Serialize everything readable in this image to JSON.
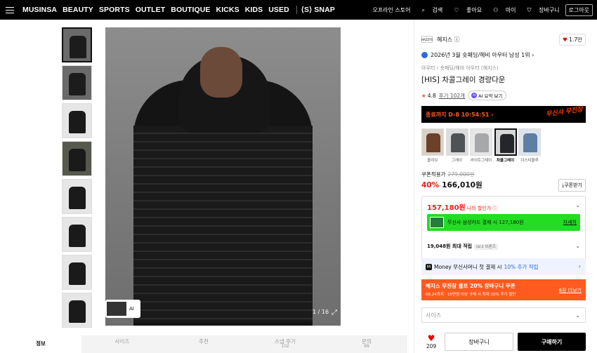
{
  "topbar": {
    "nav": [
      "MUSINSA",
      "BEAUTY",
      "SPORTS",
      "OUTLET",
      "BOUTIQUE",
      "KICKS",
      "KIDS",
      "USED"
    ],
    "snap": "⟨S⟩ SNAP",
    "util": {
      "offline": "오프라인 스토어",
      "search": "검색",
      "likes": "좋아요",
      "my": "마이",
      "cart": "장바구니",
      "logout": "로그아웃"
    }
  },
  "image": {
    "counter": "1 / 16",
    "ai_label": "AI"
  },
  "tabs": [
    {
      "label": "정보",
      "sub": ""
    },
    {
      "label": "사이즈",
      "sub": ""
    },
    {
      "label": "추천",
      "sub": ""
    },
    {
      "label": "스냅·후기",
      "sub": "102"
    },
    {
      "label": "문의",
      "sub": "98"
    }
  ],
  "product": {
    "brand_logo": "HAZZYS",
    "brand": "헤지스 ⓘ",
    "likes": "1.7만",
    "ranking": "2026년 3월 숏패딩/헤비 아우터 남성 1위 ›",
    "breadcrumb": "아우터 › 숏패딩/헤비 아우터 (헤지스)",
    "title": "[HIS] 차콜그레이 경량다운",
    "rating": "4.8",
    "reviews": "후기 102개",
    "ai_summary": "AI 요약 보기",
    "ai_dot": "AI"
  },
  "promo": {
    "timer": "종료까지 D-8 10:54:51 ›",
    "graffiti": "무신사 무진장"
  },
  "colors": [
    {
      "label": "올리브",
      "color": "#6b3f28",
      "bg": "#d9d0c8"
    },
    {
      "label": "그레이",
      "color": "#505356",
      "bg": "#dcdcdc"
    },
    {
      "label": "라이트그레이",
      "color": "#a6a8aa",
      "bg": "#e7e7e7"
    },
    {
      "label": "차콜그레이",
      "color": "#24262a",
      "bg": "#d6d6d6"
    },
    {
      "label": "더스티블루",
      "color": "#5e7ea3",
      "bg": "#dde3ea"
    }
  ],
  "pricing": {
    "coupon_label": "쿠폰적용가",
    "original": "279,000원",
    "discount": "40%",
    "price": "166,010원",
    "coupon_btn": "⤓쿠폰받기",
    "my_price": "157,180원",
    "my_price_label": "나의 할인가 ⓘ",
    "card_text": "무신사 삼성카드 결제 시 127,180원",
    "card_detail": "자세히",
    "points": "19,048원 최대 적립",
    "level": "LV.2 브론즈"
  },
  "money": {
    "icon": "M",
    "text": "Money 무신사머니 첫 결제 시",
    "highlight": "10% 추가 적립",
    "chevron": "›"
  },
  "banner": {
    "title": "헤지스 무진장 쿨프 20% 장바구니 쿠폰",
    "sub": "06.24까지 · 15만원 이상 구매 시 최대 20% 추가 할인",
    "more": "8장 더보기"
  },
  "size": {
    "placeholder": "사이즈"
  },
  "actions": {
    "likes": "209",
    "cart": "장바구니",
    "buy": "구매하기"
  }
}
